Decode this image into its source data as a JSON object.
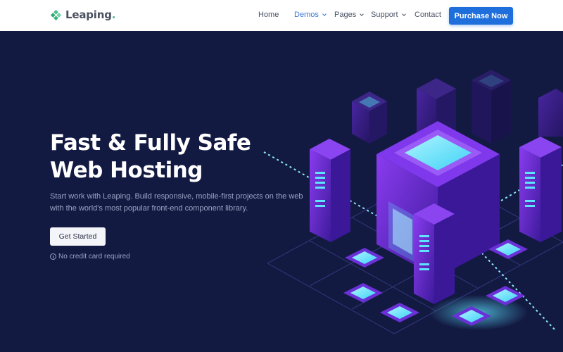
{
  "brand": {
    "name": "Leaping",
    "dot": "."
  },
  "nav": {
    "items": [
      {
        "label": "Home",
        "dropdown": false,
        "active": false
      },
      {
        "label": "Demos",
        "dropdown": true,
        "active": true
      },
      {
        "label": "Pages",
        "dropdown": true,
        "active": false
      },
      {
        "label": "Support",
        "dropdown": true,
        "active": false
      },
      {
        "label": "Contact",
        "dropdown": false,
        "active": false
      }
    ],
    "purchase_label": "Purchase Now"
  },
  "hero": {
    "title_line1": "Fast & Fully Safe",
    "title_line2": "Web Hosting",
    "description": "Start work with Leaping. Build responsive, mobile-first projects on the web with the world's most popular front-end component library.",
    "cta_label": "Get Started",
    "note": "No credit card required",
    "note_icon": "info-icon",
    "illustration": "isometric-server-hosting-illustration"
  },
  "colors": {
    "header_bg": "#ffffff",
    "hero_bg": "#131a42",
    "accent_blue": "#1e6fdc",
    "active_nav": "#3b78d8",
    "logo_green": "#4cbc8a",
    "server_purple": "#6b2fd6",
    "glow_cyan": "#5fe3ff"
  }
}
